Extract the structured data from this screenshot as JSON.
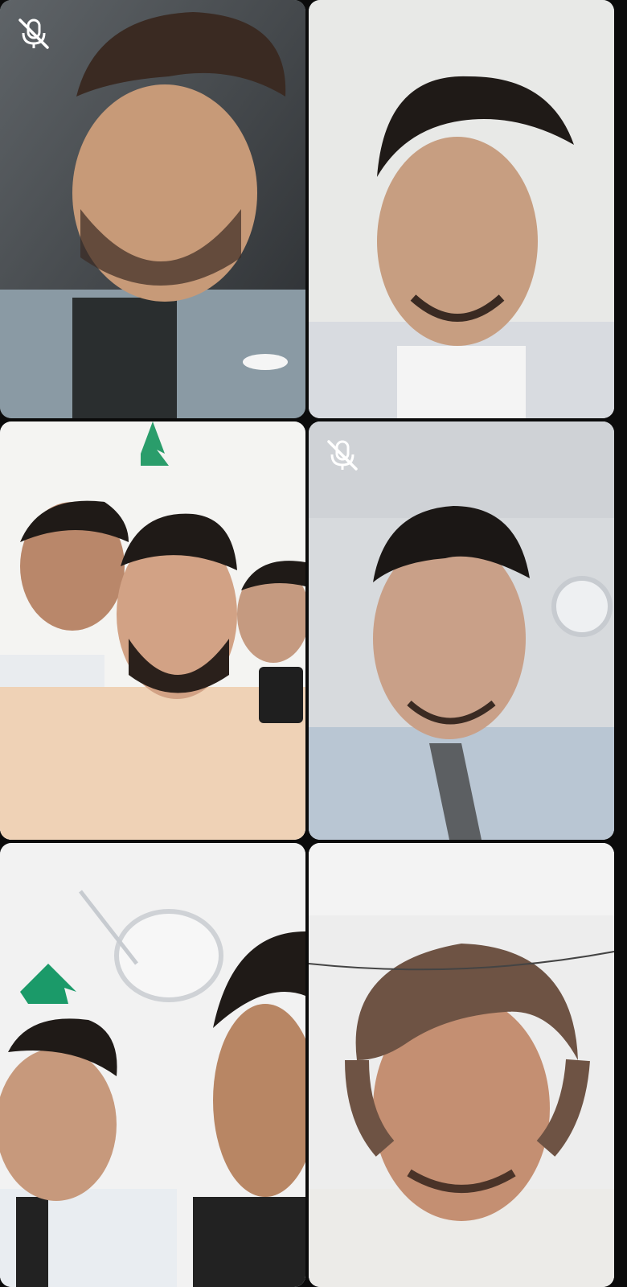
{
  "call": {
    "participants": [
      {
        "id": "p1",
        "muted": true,
        "tone": "dark-room"
      },
      {
        "id": "p2",
        "muted": false,
        "tone": "bright-room"
      },
      {
        "id": "p3",
        "muted": false,
        "tone": "group-selfie"
      },
      {
        "id": "p4",
        "muted": true,
        "tone": "office"
      },
      {
        "id": "p5",
        "muted": false,
        "tone": "ceiling-fan"
      },
      {
        "id": "p6",
        "muted": false,
        "tone": "bright-room"
      }
    ],
    "icons": {
      "mute": "microphone-off-icon"
    },
    "colors": {
      "background": "#0b0b0b",
      "tile_bg": "#9aa3a9",
      "icon": "#ffffff"
    }
  }
}
